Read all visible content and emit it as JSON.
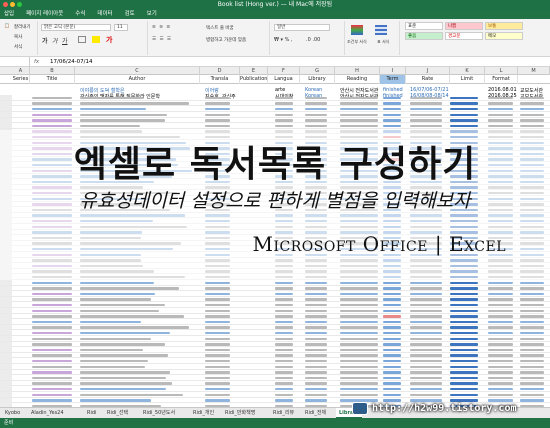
{
  "window": {
    "title": "Book list (Hong ver.) — 내 Mac에 저장됨"
  },
  "menubar": {
    "items": [
      "삽입",
      "페이지 레이아웃",
      "수식",
      "데이터",
      "검토",
      "보기"
    ]
  },
  "ribbon": {
    "clipboard": [
      "잘라내기",
      "복사",
      "서식"
    ],
    "font": {
      "name": "맑은 고딕 (본문)",
      "size": "11"
    },
    "wrap": "텍스트 줄 바꿈",
    "merge": "병합하고 가운데 맞춤",
    "number_format": "일반",
    "conditional": "조건부 서식",
    "table": "표 서식",
    "styles": [
      "표준",
      "나쁨",
      "보통",
      "좋음",
      "경고문",
      "메모"
    ]
  },
  "formula_bar": {
    "cell_ref": "fx",
    "value": "17/06/24-07/14"
  },
  "columns": {
    "letters": [
      "A",
      "B",
      "C",
      "D",
      "E",
      "F",
      "G",
      "H",
      "I",
      "J",
      "K",
      "L",
      "M"
    ],
    "fields": [
      "",
      "Series",
      "Title",
      "Author",
      "Transla",
      "Publication",
      "Langua",
      "Library",
      "Reading",
      "Term",
      "Rate",
      "Limit",
      "Format"
    ]
  },
  "sample_rows": [
    {
      "title": "이야릉의 도덕 철학은",
      "author": "이어랑",
      "pub": "arte",
      "lang": "Korean",
      "lib": "안산시 전자도서관",
      "read": "finished",
      "term": "16/07/06-07/21",
      "limit": "2016.08.01",
      "format": "교보도서관"
    },
    {
      "title": "강신주의 맹자를 통해 질문하라 인문학",
      "author": "지승호, 강신주",
      "pub": "시대의창",
      "lang": "Korean",
      "lib": "안산시 전자도서관",
      "read": "finished",
      "term": "16/08/08-08/14",
      "limit": "2016.08.25",
      "format": "교보도서관"
    }
  ],
  "overlay": {
    "headline": "엑셀로 독서목록 구성하기",
    "subheadline": "유효성데이터 설정으로 편하게 별점을 입력해보자",
    "tagline": "Microsoft Office | Excel"
  },
  "sheet_tabs": [
    "Kyobo",
    "Aladin_Yes24",
    "Ridi",
    "Ridi_선택",
    "Ridi_50년도서",
    "Ridi_개인",
    "Ridi_만화책명",
    "Ridi_리뷰",
    "Ridi_전체",
    "Library"
  ],
  "active_tab": "Library",
  "status": {
    "text": "준비"
  },
  "watermark": "http://h2w99.tistory.com",
  "colors": {
    "excel_green": "#217346",
    "term_header": "#9ec3e6",
    "finished_blue": "#2f6db5",
    "reading_red": "#d63a3a"
  }
}
